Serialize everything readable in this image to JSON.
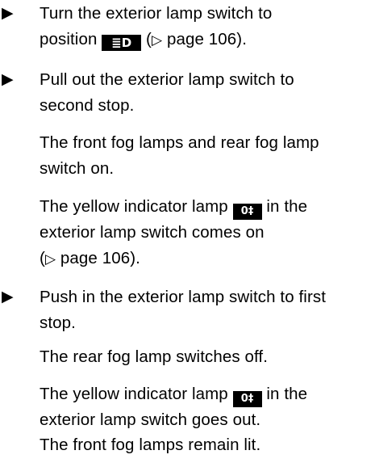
{
  "steps": [
    {
      "bullet": "▶",
      "text1": "Turn the exterior lamp switch to",
      "text2_before": "position ",
      "text2_symbol": "≣D",
      "text2_ref_open": " (",
      "text2_ref_arrow": "▷",
      "text2_ref_text": " page 106)."
    },
    {
      "bullet": "▶",
      "line1": "Pull out the exterior lamp switch to",
      "line2": "second stop."
    },
    {
      "bullet": "▶",
      "line1": "Push in the exterior lamp switch to first",
      "line2": "stop."
    }
  ],
  "results_1": {
    "para1_line1": "The front fog lamps and rear fog lamp",
    "para1_line2": "switch on.",
    "para2_line1_before": "The yellow indicator lamp ",
    "para2_symbol": "0‡",
    "para2_line1_after": " in the",
    "para2_line2": "exterior lamp switch comes on",
    "para2_line3_open": "(",
    "para2_line3_arrow": "▷",
    "para2_line3_text": " page 106)."
  },
  "results_2": {
    "para1": "The rear fog lamp switches off.",
    "para2_line1_before": "The yellow indicator lamp ",
    "para2_symbol": "0‡",
    "para2_line1_after": " in the",
    "para2_line2": "exterior lamp switch goes out.",
    "para3": "The front fog lamps remain lit."
  }
}
